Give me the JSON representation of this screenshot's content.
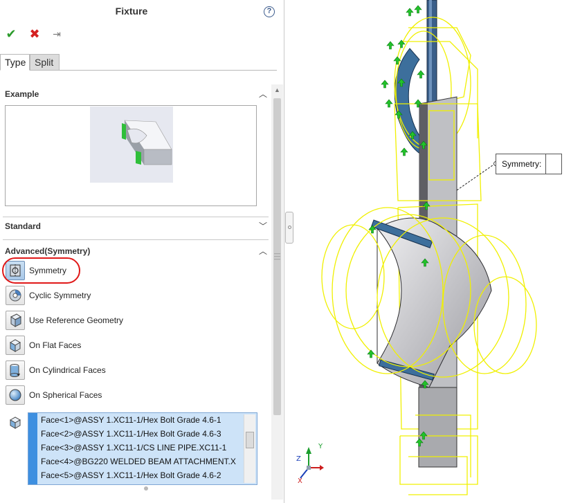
{
  "panel": {
    "title": "Fixture",
    "help_glyph": "?",
    "actions": {
      "ok": "✔",
      "cancel": "✖",
      "pin": "⇥"
    },
    "tabs": [
      {
        "label": "Type"
      },
      {
        "label": "Split"
      }
    ]
  },
  "sections": {
    "example": {
      "label": "Example"
    },
    "standard": {
      "label": "Standard"
    },
    "advanced": {
      "label": "Advanced(Symmetry)"
    }
  },
  "options": [
    {
      "label": "Symmetry",
      "icon": "symmetry-icon",
      "selected": true
    },
    {
      "label": "Cyclic Symmetry",
      "icon": "cyclic-symmetry-icon"
    },
    {
      "label": "Use Reference Geometry",
      "icon": "reference-geometry-icon"
    },
    {
      "label": "On Flat Faces",
      "icon": "flat-face-icon"
    },
    {
      "label": "On Cylindrical Faces",
      "icon": "cylindrical-face-icon"
    },
    {
      "label": "On Spherical Faces",
      "icon": "spherical-face-icon"
    }
  ],
  "faces": [
    "Face<1>@ASSY 1.XC11-1/Hex Bolt Grade 4.6-1",
    "Face<2>@ASSY 1.XC11-1/Hex Bolt Grade 4.6-3",
    "Face<3>@ASSY 1.XC11-1/CS LINE PIPE.XC11-1",
    "Face<4>@BG220 WELDED BEAM ATTACHMENT.X",
    "Face<5>@ASSY 1.XC11-1/Hex Bolt Grade 4.6-2"
  ],
  "viewport": {
    "callout": {
      "label": "Symmetry:"
    },
    "triad": {
      "x": "X",
      "y": "Y",
      "z": "Z"
    }
  },
  "colors": {
    "wireframe": "#f0f000",
    "fixture_arrow": "#22c32a",
    "highlight": "#e01818",
    "selection": "#cde3f8"
  }
}
